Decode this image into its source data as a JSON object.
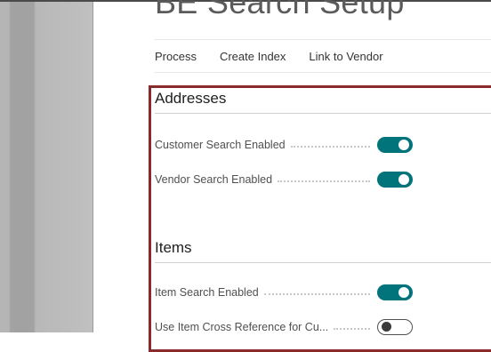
{
  "page": {
    "title": "BE Search Setup"
  },
  "actions": [
    {
      "label": "Process"
    },
    {
      "label": "Create Index"
    },
    {
      "label": "Link to Vendor"
    }
  ],
  "sections": {
    "addresses": {
      "heading": "Addresses",
      "fields": [
        {
          "label": "Customer Search Enabled",
          "enabled": true
        },
        {
          "label": "Vendor Search Enabled",
          "enabled": true
        }
      ]
    },
    "items": {
      "heading": "Items",
      "fields": [
        {
          "label": "Item Search Enabled",
          "enabled": true
        },
        {
          "label": "Use Item Cross Reference for Cu...",
          "enabled": false
        }
      ]
    }
  },
  "colors": {
    "toggle_on": "#00747a",
    "highlight_border": "#8b2a2a"
  }
}
